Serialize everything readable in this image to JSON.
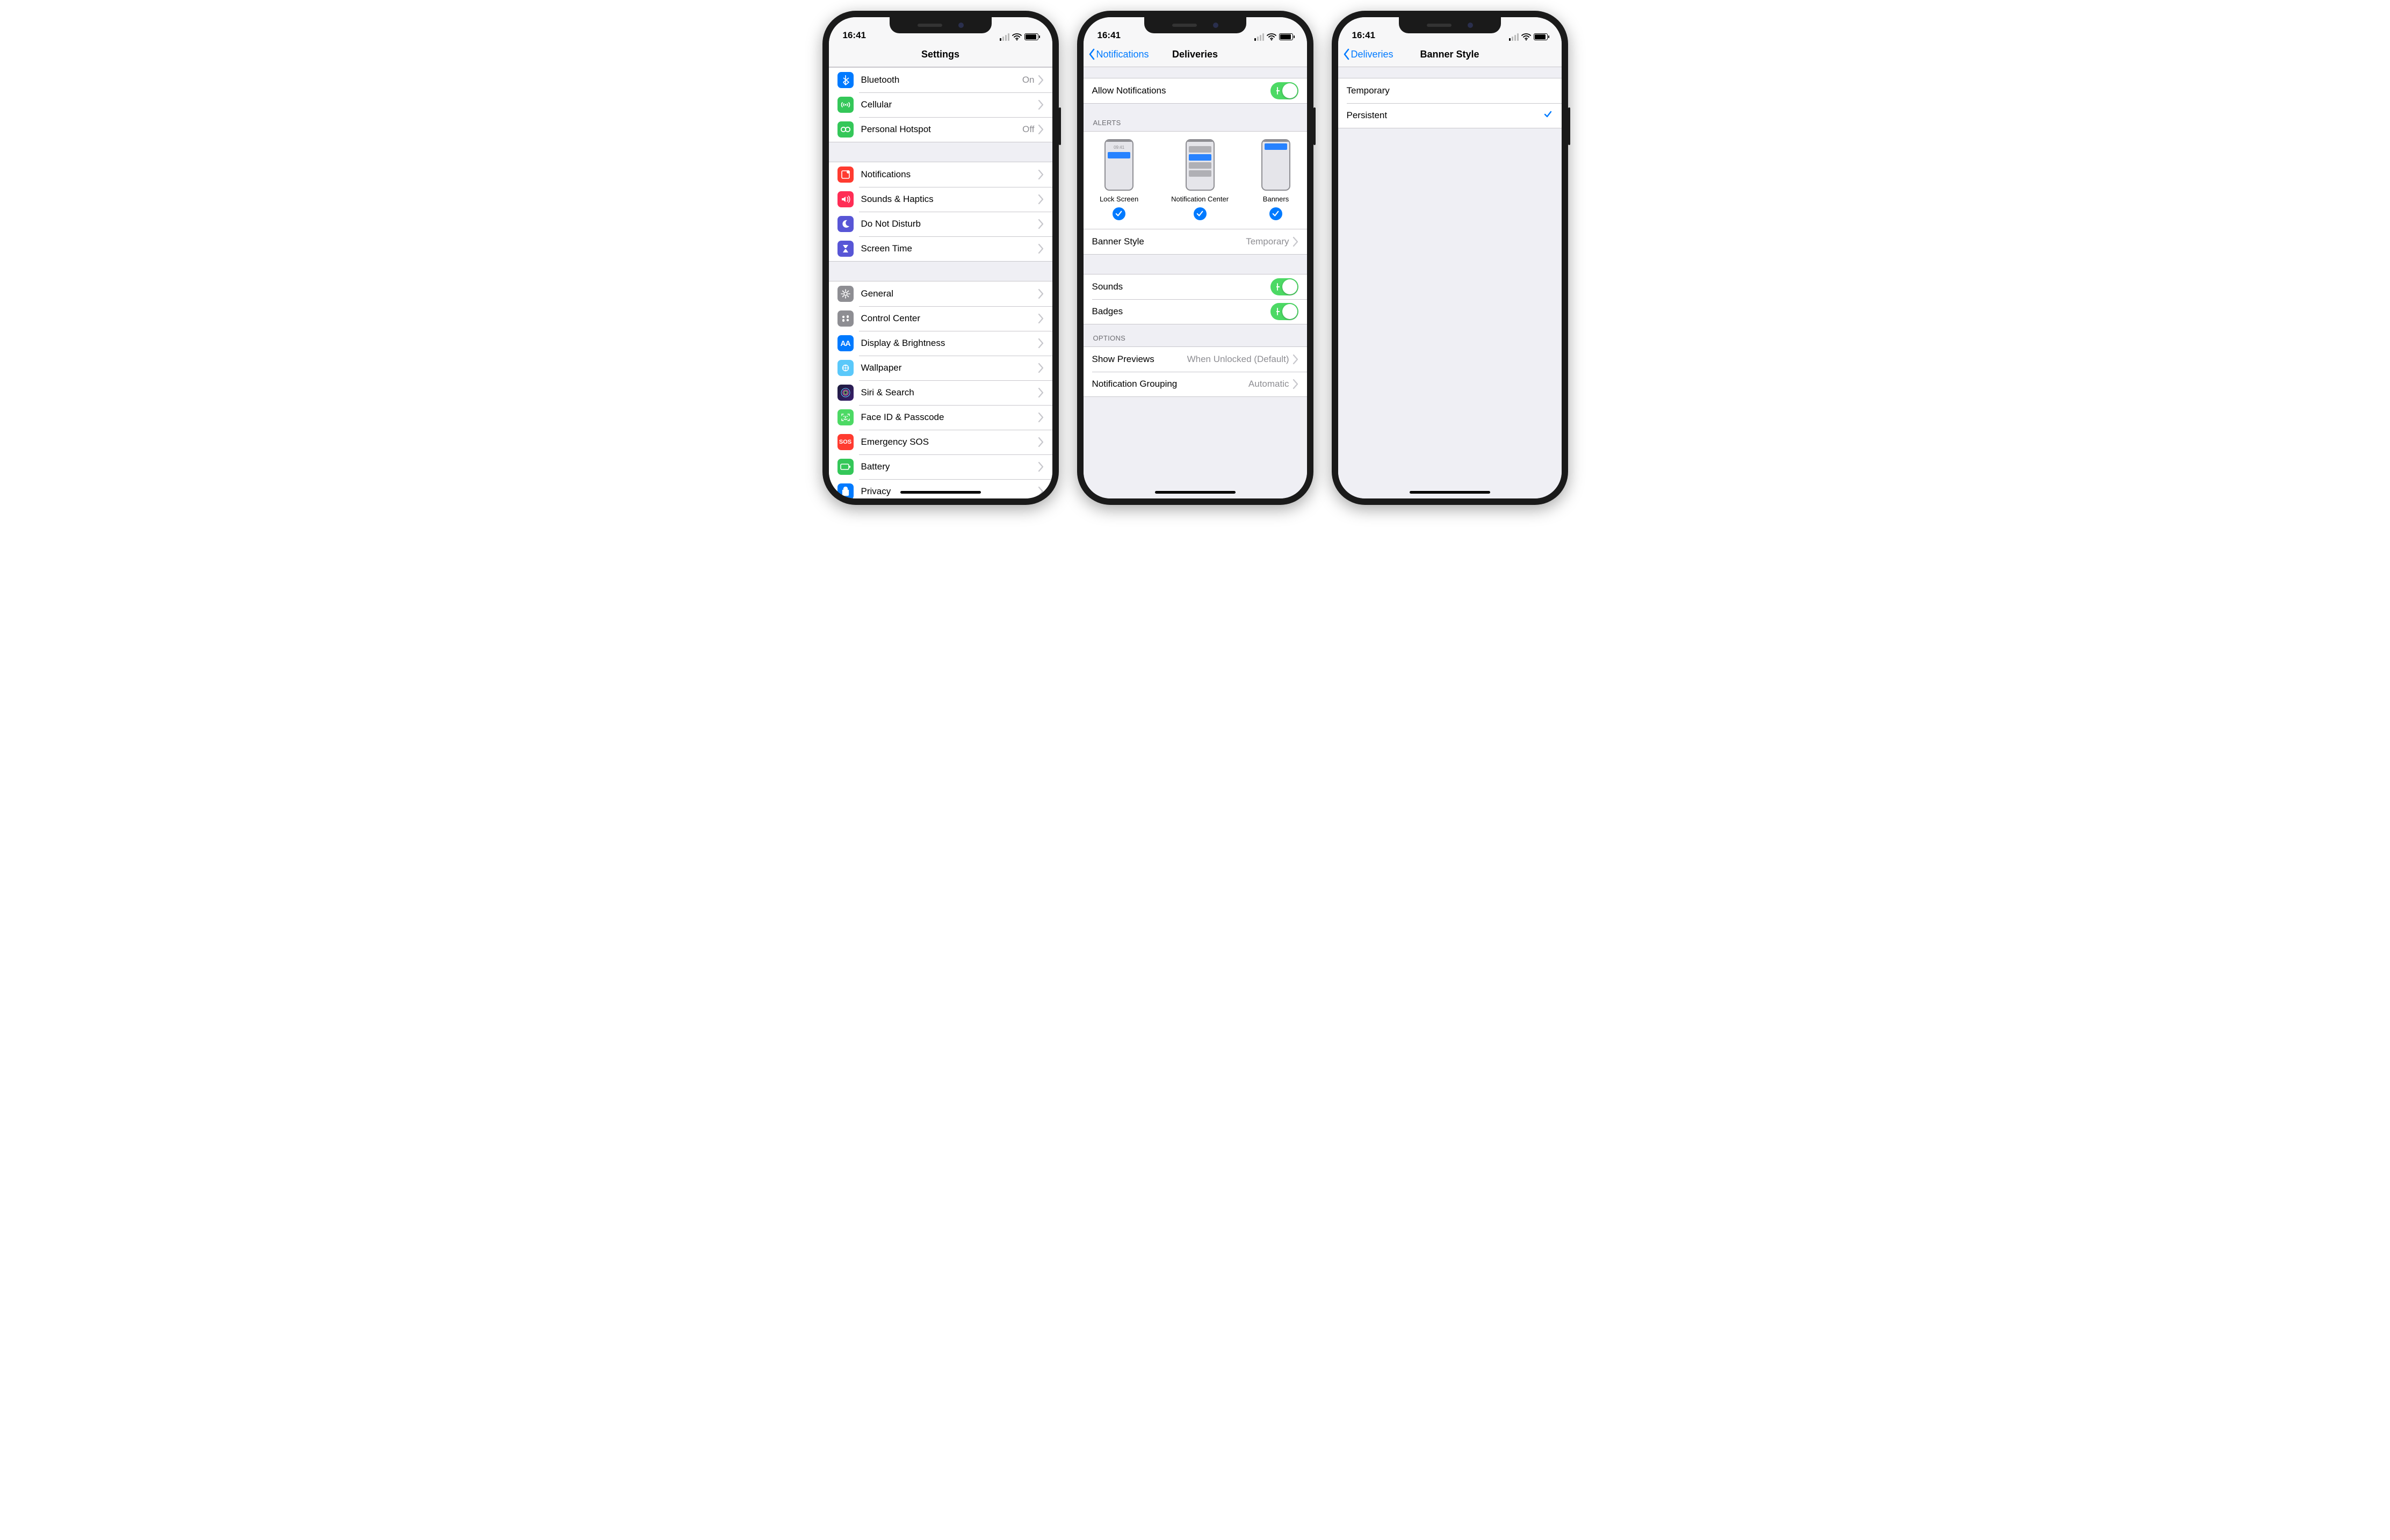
{
  "status_time": "16:41",
  "screens": {
    "settings": {
      "title": "Settings",
      "groups": [
        [
          {
            "icon": "bluetooth-icon",
            "color": "bg-blue",
            "label": "Bluetooth",
            "value": "On"
          },
          {
            "icon": "cellular-icon",
            "color": "bg-green",
            "label": "Cellular",
            "value": ""
          },
          {
            "icon": "hotspot-icon",
            "color": "bg-green",
            "label": "Personal Hotspot",
            "value": "Off"
          }
        ],
        [
          {
            "icon": "notifications-icon",
            "color": "bg-red",
            "label": "Notifications",
            "value": ""
          },
          {
            "icon": "sounds-icon",
            "color": "bg-red2",
            "label": "Sounds & Haptics",
            "value": ""
          },
          {
            "icon": "dnd-icon",
            "color": "bg-purple",
            "label": "Do Not Disturb",
            "value": ""
          },
          {
            "icon": "screentime-icon",
            "color": "bg-purple",
            "label": "Screen Time",
            "value": ""
          }
        ],
        [
          {
            "icon": "general-icon",
            "color": "bg-gray",
            "label": "General",
            "value": ""
          },
          {
            "icon": "controlcenter-icon",
            "color": "bg-gray",
            "label": "Control Center",
            "value": ""
          },
          {
            "icon": "display-icon",
            "color": "bg-blue",
            "label": "Display & Brightness",
            "value": ""
          },
          {
            "icon": "wallpaper-icon",
            "color": "bg-teal",
            "label": "Wallpaper",
            "value": ""
          },
          {
            "icon": "siri-icon",
            "color": "bg-siri",
            "label": "Siri & Search",
            "value": ""
          },
          {
            "icon": "faceid-icon",
            "color": "bg-green3",
            "label": "Face ID & Passcode",
            "value": ""
          },
          {
            "icon": "sos-icon",
            "color": "bg-red",
            "label": "Emergency SOS",
            "value": ""
          },
          {
            "icon": "battery-icon",
            "color": "bg-green",
            "label": "Battery",
            "value": ""
          },
          {
            "icon": "privacy-icon",
            "color": "bg-blue",
            "label": "Privacy",
            "value": ""
          }
        ]
      ]
    },
    "deliveries": {
      "back": "Notifications",
      "title": "Deliveries",
      "allow_label": "Allow Notifications",
      "alerts_header": "ALERTS",
      "alerts": [
        {
          "label": "Lock Screen",
          "selected": true,
          "preview_time": "09:41"
        },
        {
          "label": "Notification Center",
          "selected": true
        },
        {
          "label": "Banners",
          "selected": true
        }
      ],
      "banner_style_label": "Banner Style",
      "banner_style_value": "Temporary",
      "sounds_label": "Sounds",
      "badges_label": "Badges",
      "options_header": "OPTIONS",
      "options": [
        {
          "label": "Show Previews",
          "value": "When Unlocked (Default)"
        },
        {
          "label": "Notification Grouping",
          "value": "Automatic"
        }
      ]
    },
    "bannerstyle": {
      "back": "Deliveries",
      "title": "Banner Style",
      "options": [
        {
          "label": "Temporary",
          "selected": false
        },
        {
          "label": "Persistent",
          "selected": true
        }
      ]
    }
  }
}
